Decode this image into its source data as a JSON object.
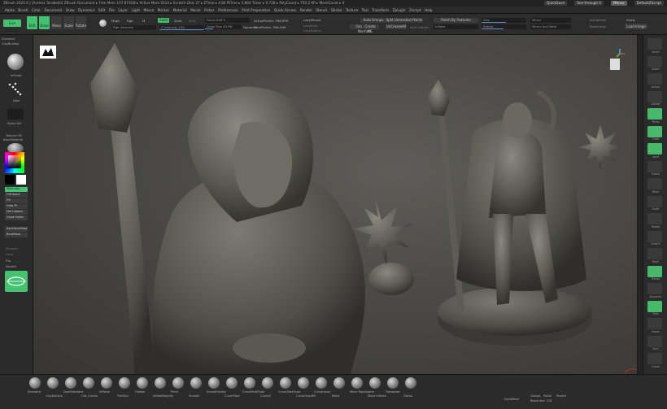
{
  "titlebar": {
    "text": "ZBrush 2025.0 | [Andrea Tarabella]  ZBrush Document   ▸ Free Mem 107.873GB ▸ Active Mem 5014 ▸ Scratch Disk 37 ▸ ZTime ▸ 4.84 RTime ▸ 4.864 Timer ▸ 0.728 ▸ PolyCount ▸ 750.2 KP ▸ MeshCount ▸ 4",
    "quicksave": "QuickSave",
    "seethrough": "See-through  0",
    "menus": "Menus",
    "defaultzscript": "DefaultZScript"
  },
  "menubar": [
    "Alpha",
    "Brush",
    "Color",
    "Document",
    "Draw",
    "Dynamics",
    "Edit",
    "File",
    "Layer",
    "Light",
    "Macro",
    "Marker",
    "Material",
    "Movie",
    "Picker",
    "Preferences",
    "Print Preparation",
    "Quick Access",
    "Render",
    "Stencil",
    "Stroke",
    "Texture",
    "Tool",
    "Transform",
    "Zplugin",
    "Zscript",
    "Help"
  ],
  "toolbar": {
    "live_boolean": "Live Boolean",
    "edit": "Edit",
    "draw": "Draw",
    "move": "Move",
    "scale": "Scale",
    "rotate": "Rotate",
    "mrgb": "Mrgb",
    "rgb": "Rgb",
    "m": "M",
    "rgb_intensity": "Rgb Intensity",
    "zadd": "Zadd",
    "zsub": "Zsub",
    "zcut": "Zcut",
    "focal_shift": "Focal Shift  0",
    "z_intensity": "Z Intensity  100",
    "draw_size": "Draw Size  40.96",
    "dynamic": "Dynamic",
    "active_points": "ActivePoints: 396,999",
    "total_points": "TotalPoints: 396,999",
    "lazymouse": "LazyMouse",
    "lazystep": "LazyStep",
    "lazyradius": "LazyRadius",
    "auto_groups": "Auto Groups",
    "groups_by_normals": "Groups By Normals",
    "create_pg": "Create PG",
    "split_unmasked": "Split Unmasked Points",
    "uncreasell": "UnCreaseAll",
    "split_hidden": "Split Hidden",
    "polish_by_features": "Polish By Features",
    "inflate": "Inflate",
    "size": "Size",
    "rotate2": "Rotate",
    "mirror": "Mirror",
    "mirror_and_weld": "Mirror And Weld",
    "dynamesh": "DynaMesh",
    "resolution": "Resolution",
    "show": "Show",
    "load_image": "Load Image"
  },
  "leftshelf": {
    "items": [
      "Standard",
      "ClayBuildup",
      "InPolish",
      "Dots",
      "Alpha Off",
      "Texture Off",
      "BasicMaterial"
    ],
    "buttons": [
      "Alternate",
      "FillObject",
      "Fill",
      "Hide Pt",
      "Del Hidden",
      "Close Holes",
      "BackfaceMask",
      "BluriMask"
    ],
    "labels": [
      "Sharpen",
      "Grow",
      "Flip",
      "Double"
    ]
  },
  "rightshelf": {
    "labels": [
      "Scroll",
      "Zoom",
      "Actual",
      "AAHalf",
      "Persp",
      "Floor",
      "Local",
      "Frame",
      "Move",
      "Scale",
      "Rotate",
      "LineFill",
      "PolyF",
      "Transp",
      "Dynamic",
      "Solo",
      "Xpose",
      "Sym",
      "Ghost"
    ]
  },
  "bottomshelf": {
    "brushes": [
      "Standard",
      "ClayBuildup",
      "DamStandard",
      "Orb_Cracks",
      "InPolish",
      "TrimDyn",
      "Flatten",
      "InflateMagnify",
      "Pinch",
      "Smooth",
      "SmoothValley",
      "CurveTube",
      "CurveMultiTube",
      "CurveQ",
      "CurveTubeSnap",
      "CurveQuadFill",
      "CurveLasso",
      "Move",
      "Move Topological",
      "Move Infinite",
      "Transpose",
      "Gizmo"
    ],
    "dynamesh": "DynaMesh",
    "groups": "Groups",
    "polish": "Polish",
    "project": "Project",
    "resolution": "Resolution  128"
  },
  "colors": {
    "accent_green": "#44c270",
    "canvas_bg": "#4d4c48",
    "ui_bg": "#2b2b2b"
  }
}
